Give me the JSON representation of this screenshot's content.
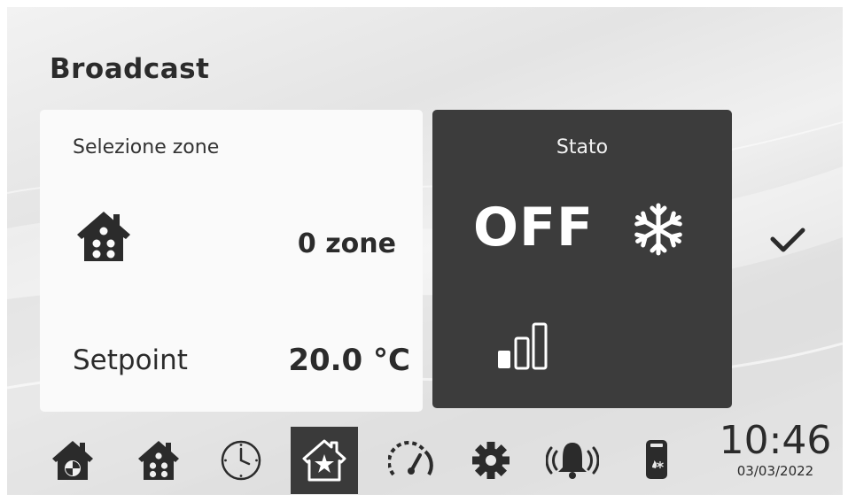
{
  "header": {
    "title": "Broadcast"
  },
  "zone_card": {
    "label": "Selezione zone",
    "icon": "house-icon",
    "zones_value": "0 zone",
    "setpoint_label": "Setpoint",
    "setpoint_value": "20.0 °C"
  },
  "status_card": {
    "label": "Stato",
    "state": "OFF",
    "mode_icon": "snowflake-icon",
    "fan_icon": "fan-speed-bars-icon"
  },
  "confirm": {
    "icon": "checkmark-icon"
  },
  "nav": {
    "items": [
      {
        "icon": "zone-house-icon",
        "active": false
      },
      {
        "icon": "house-icon",
        "active": false
      },
      {
        "icon": "clock-icon",
        "active": false
      },
      {
        "icon": "star-house-icon",
        "active": true
      },
      {
        "icon": "gauge-icon",
        "active": false
      },
      {
        "icon": "gear-icon",
        "active": false
      },
      {
        "icon": "alarm-bell-icon",
        "active": false
      },
      {
        "icon": "water-heater-icon",
        "active": false
      }
    ]
  },
  "clock": {
    "time": "10:46",
    "date": "03/03/2022"
  },
  "colors": {
    "dark_card": "#3c3c3c",
    "light_card": "#fafafa",
    "text": "#2b2b2b"
  }
}
